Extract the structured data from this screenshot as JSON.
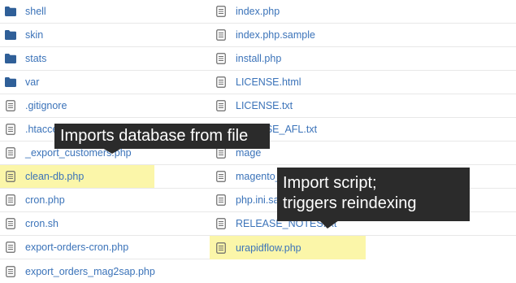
{
  "colors": {
    "link": "#3b73b9",
    "folder_icon": "#2f5f98",
    "file_icon": "#6b6b6b",
    "highlight": "#fbf6a9",
    "tooltip_bg": "#2b2b2b"
  },
  "left_column": [
    {
      "name": "shell",
      "icon": "folder-icon",
      "highlighted": false
    },
    {
      "name": "skin",
      "icon": "folder-icon",
      "highlighted": false
    },
    {
      "name": "stats",
      "icon": "folder-icon",
      "highlighted": false
    },
    {
      "name": "var",
      "icon": "folder-icon",
      "highlighted": false
    },
    {
      "name": ".gitignore",
      "icon": "file-icon",
      "highlighted": false
    },
    {
      "name": ".htaccess",
      "icon": "file-icon",
      "highlighted": false
    },
    {
      "name": "_export_customers.php",
      "icon": "file-icon",
      "highlighted": false
    },
    {
      "name": "clean-db.php",
      "icon": "file-icon",
      "highlighted": true
    },
    {
      "name": "cron.php",
      "icon": "file-icon",
      "highlighted": false
    },
    {
      "name": "cron.sh",
      "icon": "file-icon",
      "highlighted": false
    },
    {
      "name": "export-orders-cron.php",
      "icon": "file-icon",
      "highlighted": false
    },
    {
      "name": "export_orders_mag2sap.php",
      "icon": "file-icon",
      "highlighted": false
    }
  ],
  "right_column": [
    {
      "name": "index.php",
      "icon": "file-icon",
      "highlighted": false
    },
    {
      "name": "index.php.sample",
      "icon": "file-icon",
      "highlighted": false
    },
    {
      "name": "install.php",
      "icon": "file-icon",
      "highlighted": false
    },
    {
      "name": "LICENSE.html",
      "icon": "file-icon",
      "highlighted": false
    },
    {
      "name": "LICENSE.txt",
      "icon": "file-icon",
      "highlighted": false
    },
    {
      "name": "LICENSE_AFL.txt",
      "icon": "file-icon",
      "highlighted": false
    },
    {
      "name": "mage",
      "icon": "file-icon",
      "highlighted": false
    },
    {
      "name": "magento_",
      "icon": "file-icon",
      "highlighted": false
    },
    {
      "name": "php.ini.sample",
      "icon": "file-icon",
      "highlighted": false
    },
    {
      "name": "RELEASE_NOTES.txt",
      "icon": "file-icon",
      "highlighted": false
    },
    {
      "name": "urapidflow.php",
      "icon": "file-icon",
      "highlighted": true
    }
  ],
  "tooltips": {
    "clean_db": "Imports database from file",
    "urapidflow": [
      "Import script;",
      "triggers reindexing"
    ]
  }
}
